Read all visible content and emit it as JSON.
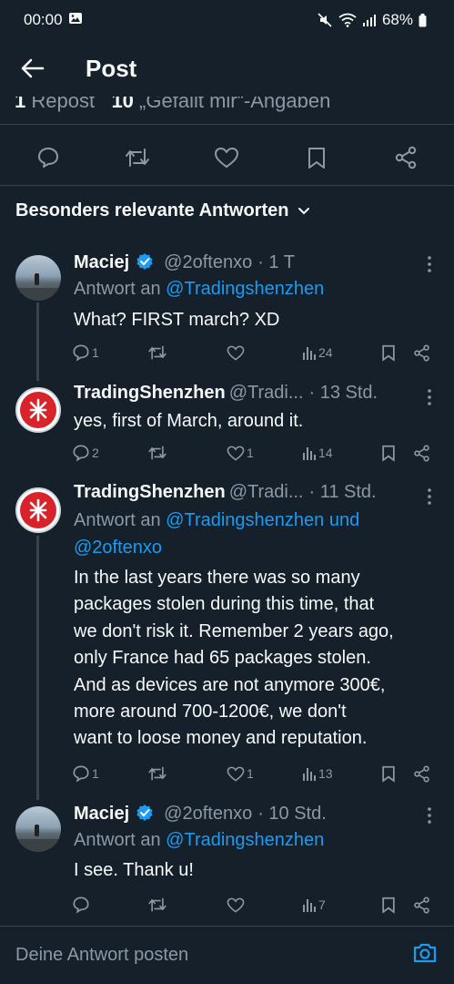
{
  "status": {
    "time": "00:00",
    "battery": "68%"
  },
  "header": {
    "title": "Post"
  },
  "stats": {
    "reposts_count": "1",
    "reposts_label": "Repost",
    "likes_count": "10",
    "likes_label": "„Gefällt mir“-Angaben"
  },
  "sort": {
    "label": "Besonders relevante Antworten"
  },
  "tweets": [
    {
      "name": "Maciej",
      "handle": "@2oftenxo",
      "time": "· 1 T",
      "reply_prefix": "Antwort an",
      "reply_mention": "@Tradingshenzhen",
      "text": "What? FIRST march? XD",
      "replies": "1",
      "retweets": "",
      "likes": "",
      "views": "24"
    },
    {
      "name": "TradingShenzhen",
      "handle": "@Tradi...",
      "time": "· 13 Std.",
      "text": "yes, first of March, around it.",
      "replies": "2",
      "retweets": "",
      "likes": "1",
      "views": "14"
    },
    {
      "name": "TradingShenzhen",
      "handle": "@Tradi...",
      "time": "· 11 Std.",
      "reply_prefix": "Antwort an",
      "reply_mention": "@Tradingshenzhen und @2oftenxo",
      "text_lines": [
        "In the last years there was so many",
        "packages stolen during this time, that",
        "we don't risk it. Remember 2 years ago,",
        "only France had 65 packages stolen.",
        "And as devices are not anymore 300€,",
        "more around 700-1200€, we don't",
        "want to loose money and reputation."
      ],
      "replies": "1",
      "retweets": "",
      "likes": "1",
      "views": "13"
    },
    {
      "name": "Maciej",
      "handle": "@2oftenxo",
      "time": "· 10 Std.",
      "reply_prefix": "Antwort an",
      "reply_mention": "@Tradingshenzhen",
      "text": "I see. Thank u!",
      "replies": "",
      "retweets": "",
      "likes": "",
      "views": "7"
    }
  ],
  "compose": {
    "placeholder": "Deine Antwort posten"
  },
  "colors": {
    "background": "#15202b",
    "accent": "#1d9bf0",
    "muted": "#8b98a5",
    "divider": "#38444d"
  }
}
